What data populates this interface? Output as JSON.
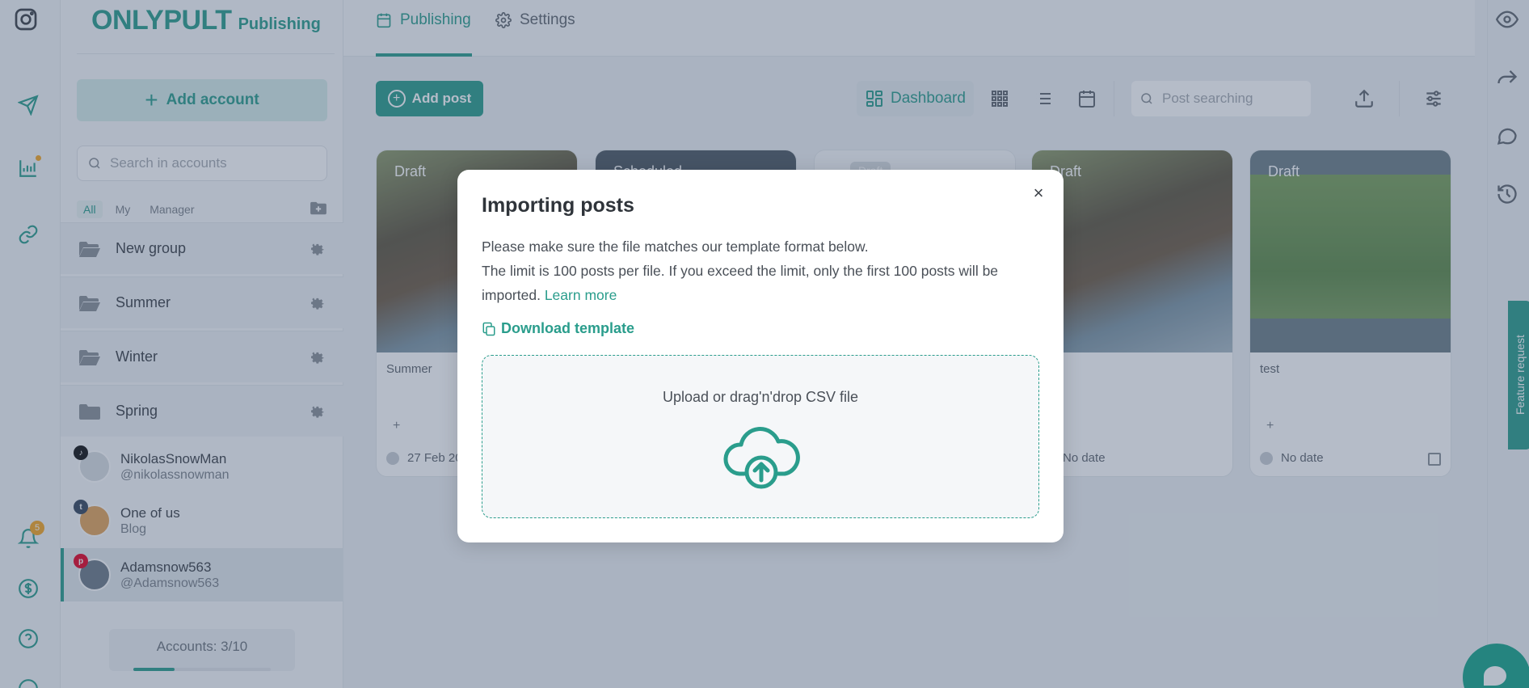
{
  "app": {
    "brand": "ONLYPULT",
    "product": "Publishing"
  },
  "rail": {
    "notification_count": "5",
    "icons": [
      "instagram-icon",
      "send-icon",
      "analytics-icon",
      "link-icon",
      "bell-icon",
      "dollar-icon",
      "help-icon"
    ]
  },
  "sidebar": {
    "add_account_label": "Add account",
    "search_placeholder": "Search in accounts",
    "filters": [
      "All",
      "My",
      "Manager"
    ],
    "groups": [
      "New group",
      "Summer",
      "Winter",
      "Spring"
    ],
    "accounts": [
      {
        "name": "NikolasSnowMan",
        "handle": "@nikolassnowman",
        "network": "tiktok"
      },
      {
        "name": "One of us",
        "handle": "Blog",
        "network": "tumblr"
      },
      {
        "name": "Adamsnow563",
        "handle": "@Adamsnow563",
        "network": "pinterest"
      }
    ],
    "accounts_count": "Accounts: 3/10",
    "accounts_fraction": 0.3
  },
  "topbar": {
    "tabs": [
      {
        "label": "Publishing",
        "active": true
      },
      {
        "label": "Settings",
        "active": false
      }
    ]
  },
  "toolbar": {
    "add_post_label": "Add post",
    "view_dashboard_label": "Dashboard",
    "search_placeholder": "Post searching"
  },
  "cards": [
    {
      "status": "Draft",
      "title": "Summer",
      "date": "27 Feb 20"
    },
    {
      "status": "Scheduled",
      "title": "",
      "date": ""
    },
    {
      "status": "Draft",
      "title": "",
      "date": ""
    },
    {
      "status": "Draft",
      "title": "mer",
      "date": "No date"
    },
    {
      "status": "Draft",
      "title": "test",
      "date": "No date"
    }
  ],
  "side_tab": {
    "label": "Feature request"
  },
  "modal": {
    "title": "Importing posts",
    "line1": "Please make sure the file matches our template format below.",
    "line2": "The limit is 100 posts per file. If you exceed the limit, only the first 100 posts will be imported.",
    "learn_more": "Learn more",
    "download_label": "Download template",
    "drop_label": "Upload or drag'n'drop CSV file",
    "close_symbol": "×"
  },
  "colors": {
    "accent": "#2a9d8c",
    "overlay": "rgba(60,80,110,0.38)"
  }
}
